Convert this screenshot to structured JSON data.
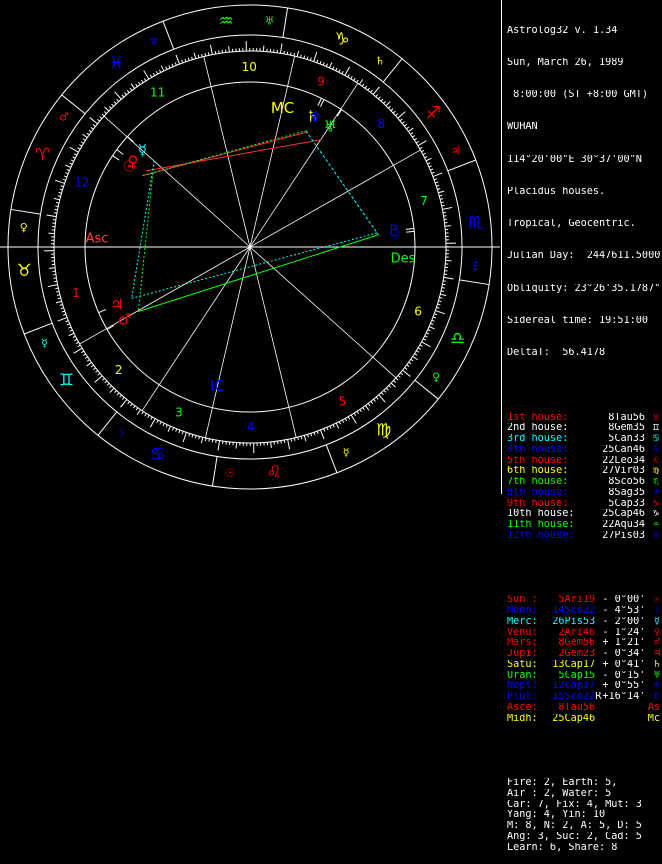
{
  "app": {
    "title": "Astrolog32 v. 1.34"
  },
  "chart_info": {
    "date": "Sun, March 26, 1989",
    "time": " 8:00:00 (ST +8:00 GMT)",
    "place": "WUHAN",
    "coords": "114°20'00\"E 30°37'00\"N",
    "house_system": "Placidus houses.",
    "zodiac": "Tropical, Geocentric.",
    "julian_day": "Julian Day:  2447611.5000",
    "obliquity": "Obliquity: 23°26'35.1787\"",
    "sidereal_time": "Sidereal time: 19:51:00",
    "delta_t": "DeltaT:  56.4178"
  },
  "houses": [
    {
      "name": "1st house:",
      "cusp": "8Tau56",
      "glyph": "♉",
      "color": "#ff0000"
    },
    {
      "name": "2nd house:",
      "cusp": "8Gem35",
      "glyph": "♊",
      "color": "#ffffff"
    },
    {
      "name": "3rd house:",
      "cusp": "5Can33",
      "glyph": "♋",
      "color": "#00ffff"
    },
    {
      "name": "4th house:",
      "cusp": "25Can46",
      "glyph": "♋",
      "color": "#0000ff"
    },
    {
      "name": "5th house:",
      "cusp": "22Leo34",
      "glyph": "♌",
      "color": "#ff0000"
    },
    {
      "name": "6th house:",
      "cusp": "27Vir03",
      "glyph": "♍",
      "color": "#ffff00"
    },
    {
      "name": "7th house:",
      "cusp": "8Sco56",
      "glyph": "♏",
      "color": "#00ff00"
    },
    {
      "name": "8th house:",
      "cusp": "8Sag35",
      "glyph": "♐",
      "color": "#0000ff"
    },
    {
      "name": "9th house:",
      "cusp": "5Cap33",
      "glyph": "♑",
      "color": "#ff0000"
    },
    {
      "name": "10th house:",
      "cusp": "25Cap46",
      "glyph": "♑",
      "color": "#ffffff"
    },
    {
      "name": "11th house:",
      "cusp": "22Aqu34",
      "glyph": "♒",
      "color": "#00ff00"
    },
    {
      "name": "12th house:",
      "cusp": "27Pis03",
      "glyph": "♓",
      "color": "#0000ff"
    }
  ],
  "planets": [
    {
      "name": "Sun :",
      "pos": "5Ari19",
      "rx": " ",
      "lat": "- 0°00'",
      "glyph": "☉",
      "color": "#ff0000"
    },
    {
      "name": "Moon:",
      "pos": "14Sco22",
      "rx": " ",
      "lat": "- 4°53'",
      "glyph": "☽",
      "color": "#0000ff"
    },
    {
      "name": "Merc:",
      "pos": "26Pis53",
      "rx": " ",
      "lat": "- 2°00'",
      "glyph": "☿",
      "color": "#00ffff"
    },
    {
      "name": "Venu:",
      "pos": "2Ari46",
      "rx": " ",
      "lat": "- 1°24'",
      "glyph": "♀",
      "color": "#ff0000"
    },
    {
      "name": "Mars:",
      "pos": "8Gem56",
      "rx": " ",
      "lat": "+ 1°21'",
      "glyph": "♂",
      "color": "#ff0000"
    },
    {
      "name": "Jupi:",
      "pos": "2Gem23",
      "rx": " ",
      "lat": "- 0°34'",
      "glyph": "♃",
      "color": "#ff0000"
    },
    {
      "name": "Satu:",
      "pos": "13Cap17",
      "rx": " ",
      "lat": "+ 0°41'",
      "glyph": "♄",
      "color": "#ffff00"
    },
    {
      "name": "Uran:",
      "pos": "5Cap15",
      "rx": " ",
      "lat": "- 0°15'",
      "glyph": "♅",
      "color": "#00ff00"
    },
    {
      "name": "Nept:",
      "pos": "12Cap17",
      "rx": " ",
      "lat": "+ 0°55'",
      "glyph": "♆",
      "color": "#0000ff"
    },
    {
      "name": "Plut:",
      "pos": "15Sco22",
      "rx": "R",
      "lat": "+16°14'",
      "glyph": "♇",
      "color": "#0000ff"
    },
    {
      "name": "Asce:",
      "pos": "8Tau56",
      "rx": " ",
      "lat": "",
      "glyph": "As",
      "color": "#ff0000"
    },
    {
      "name": "Midh:",
      "pos": "25Cap46",
      "rx": " ",
      "lat": "",
      "glyph": "Mc",
      "color": "#ffff00"
    }
  ],
  "stats": [
    "Fire: 2, Earth: 5,",
    "Air : 2, Water: 5",
    "Car: 7, Fix: 4, Mut: 3",
    "Yang: 4, Yin: 10",
    "M: 8, N: 2, A: 5, D: 5",
    "Ang: 3, Suc: 2, Cad: 5",
    "Learn: 6, Share: 8"
  ],
  "wheel": {
    "signs": [
      {
        "glyph": "♈",
        "color": "#ff0000"
      },
      {
        "glyph": "♉",
        "color": "#ffff00"
      },
      {
        "glyph": "♊",
        "color": "#00ffff"
      },
      {
        "glyph": "♋",
        "color": "#0000ff"
      },
      {
        "glyph": "♌",
        "color": "#ff0000"
      },
      {
        "glyph": "♍",
        "color": "#ffff00"
      },
      {
        "glyph": "♎",
        "color": "#00ff00"
      },
      {
        "glyph": "♏",
        "color": "#0000ff"
      },
      {
        "glyph": "♐",
        "color": "#ff0000"
      },
      {
        "glyph": "♑",
        "color": "#ffff00"
      },
      {
        "glyph": "♒",
        "color": "#00ff00"
      },
      {
        "glyph": "♓",
        "color": "#0000ff"
      }
    ],
    "rulers": [
      {
        "glyph": "♂",
        "color": "#ff0000"
      },
      {
        "glyph": "♀",
        "color": "#ffff00"
      },
      {
        "glyph": "☿",
        "color": "#00ffff"
      },
      {
        "glyph": "☽",
        "color": "#0000ff"
      },
      {
        "glyph": "☉",
        "color": "#ff0000"
      },
      {
        "glyph": "☿",
        "color": "#ffff00"
      },
      {
        "glyph": "♀",
        "color": "#00ff00"
      },
      {
        "glyph": "♇",
        "color": "#0000ff"
      },
      {
        "glyph": "♃",
        "color": "#ff0000"
      },
      {
        "glyph": "♄",
        "color": "#ffff00"
      },
      {
        "glyph": "♅",
        "color": "#00ff00"
      },
      {
        "glyph": "♆",
        "color": "#0000ff"
      }
    ],
    "house_numbers": [
      {
        "label": "1",
        "color": "#ff0000"
      },
      {
        "label": "2",
        "color": "#ffff00"
      },
      {
        "label": "3",
        "color": "#00ff00"
      },
      {
        "label": "4",
        "color": "#0000ff"
      },
      {
        "label": "5",
        "color": "#ff0000"
      },
      {
        "label": "6",
        "color": "#ffff00"
      },
      {
        "label": "7",
        "color": "#00ff00"
      },
      {
        "label": "8",
        "color": "#0000ff"
      },
      {
        "label": "9",
        "color": "#ff0000"
      },
      {
        "label": "10",
        "color": "#ffff00"
      },
      {
        "label": "11",
        "color": "#00ff00"
      },
      {
        "label": "12",
        "color": "#0000ff"
      }
    ],
    "angle_labels": {
      "asc": "Asc",
      "des": "Des",
      "mc": "MC",
      "ic": "IC"
    },
    "aspect_colors": {
      "red": "#ff3030",
      "green": "#00ff00",
      "cyan": "#00ffff"
    }
  }
}
